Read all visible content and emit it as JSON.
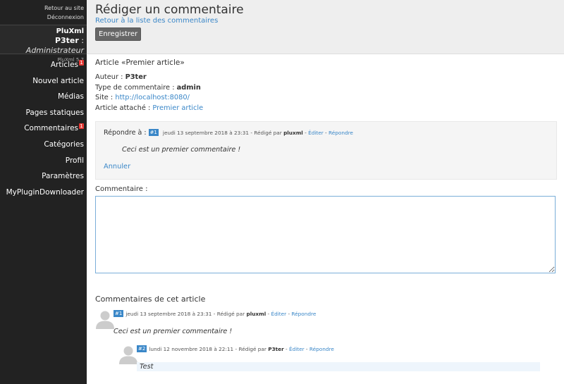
{
  "sidebar": {
    "top_links": [
      "Retour au site",
      "Déconnexion"
    ],
    "site_name": "PluXml",
    "user_name": "P3ter",
    "user_role": "Administrateur",
    "version": "PluXml 5.7",
    "menu": [
      {
        "label": "Articles",
        "badge": "1"
      },
      {
        "label": "Nouvel article",
        "badge": ""
      },
      {
        "label": "Médias",
        "badge": ""
      },
      {
        "label": "Pages statiques",
        "badge": ""
      },
      {
        "label": "Commentaires",
        "badge": "1"
      },
      {
        "label": "Catégories",
        "badge": ""
      },
      {
        "label": "Profil",
        "badge": ""
      },
      {
        "label": "Paramètres",
        "badge": ""
      },
      {
        "label": "MyPluginDownloader",
        "badge": ""
      }
    ]
  },
  "header": {
    "title": "Rédiger un commentaire",
    "back_link": "Retour à la liste des commentaires",
    "save_label": "Enregistrer"
  },
  "article": {
    "title": "Article «Premier article»",
    "author_label": "Auteur :",
    "author": "P3ter",
    "type_label": "Type de commentaire :",
    "type": "admin",
    "site_label": "Site :",
    "site": "http://localhost:8080/",
    "attached_label": "Article attaché :",
    "attached": "Premier article"
  },
  "reply": {
    "label": "Répondre à :",
    "badge": "#1",
    "date": "jeudi 13 septembre 2018 à 23:31",
    "by": "- Rédigé par",
    "author": "pluxml",
    "edit": "Éditer",
    "answer": "Répondre",
    "content": "Ceci est un premier commentaire !",
    "cancel": "Annuler"
  },
  "form": {
    "comment_label": "Commentaire :",
    "comment_value": ""
  },
  "comments": {
    "title": "Commentaires de cet article",
    "items": [
      {
        "badge": "#1",
        "date": "jeudi 13 septembre 2018 à 23:31",
        "by": "- Rédigé par",
        "author": "pluxml",
        "edit": "Éditer",
        "answer": "Répondre",
        "content": "Ceci est un premier commentaire !"
      },
      {
        "badge": "#2",
        "date": "lundi 12 novembre 2018 à 22:11",
        "by": "- Rédigé par",
        "author": "P3ter",
        "edit": "Éditer",
        "answer": "Répondre",
        "content": "Test"
      }
    ]
  },
  "colors": {
    "sidebar": "#222222",
    "accent": "#3a87c8",
    "badge": "#e53935"
  }
}
